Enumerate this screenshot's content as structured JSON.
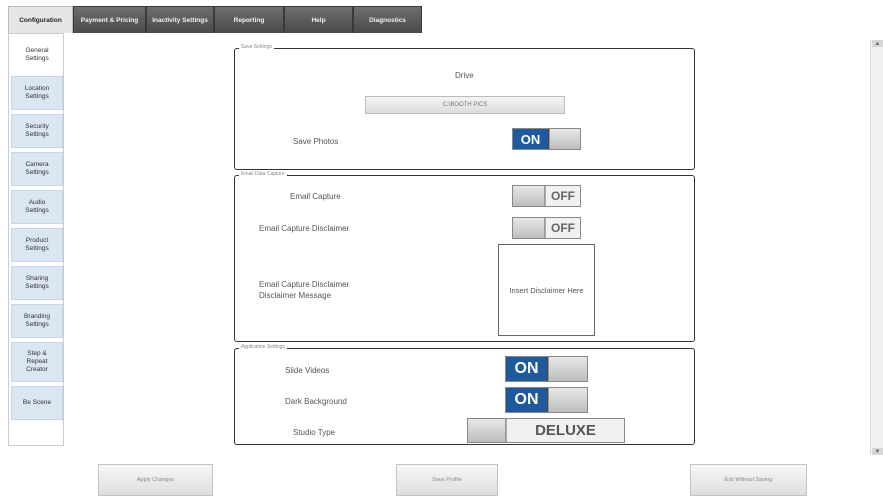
{
  "tabs": [
    {
      "label": "Configuration",
      "active": true
    },
    {
      "label": "Payment & Pricing",
      "active": false
    },
    {
      "label": "Inactivity Settings",
      "active": false
    },
    {
      "label": "Reporting",
      "active": false
    },
    {
      "label": "Help",
      "active": false
    },
    {
      "label": "Diagnostics",
      "active": false
    }
  ],
  "sidebar": {
    "items": [
      {
        "label": "General\nSettings",
        "active": true
      },
      {
        "label": "Location\nSettings",
        "active": false
      },
      {
        "label": "Security\nSettings",
        "active": false
      },
      {
        "label": "Camera\nSettings",
        "active": false
      },
      {
        "label": "Audio\nSettings",
        "active": false
      },
      {
        "label": "Product\nSettings",
        "active": false
      },
      {
        "label": "Sharing\nSettings",
        "active": false
      },
      {
        "label": "Branding\nSettings",
        "active": false
      },
      {
        "label": "Step &\nRepeat\nCreator",
        "active": false
      },
      {
        "label": "Be Scene",
        "active": false
      }
    ]
  },
  "save_settings": {
    "legend": "Save Settings",
    "drive_label": "Drive",
    "drive_button": "C:\\BOOTH PICS",
    "save_photos_label": "Save Photos",
    "save_photos_state": "ON"
  },
  "email_capture": {
    "legend": "Email Data Capture",
    "email_capture_label": "Email Capture",
    "email_capture_state": "OFF",
    "disclaimer_label": "Email Capture Disclaimer",
    "disclaimer_state": "OFF",
    "message_label_line1": "Email Capture Disclaimer",
    "message_label_line2": "Disclaimer Message",
    "message_box_text": "Insert Disclaimer Here"
  },
  "display_settings": {
    "legend": "Application Settings",
    "slide_videos_label": "Slide Videos",
    "slide_videos_state": "ON",
    "dark_background_label": "Dark Background",
    "dark_background_state": "ON",
    "studio_type_label": "Studio Type",
    "studio_type_value": "DELUXE"
  },
  "bottom_buttons": {
    "apply": "Apply Changes",
    "save": "Save Profile",
    "exit": "Exit Without Saving"
  },
  "colors": {
    "toggle_on": "#1f5b9c",
    "tab_dark": "#4a4a4a",
    "sidebar_item": "#dbe6f3"
  }
}
